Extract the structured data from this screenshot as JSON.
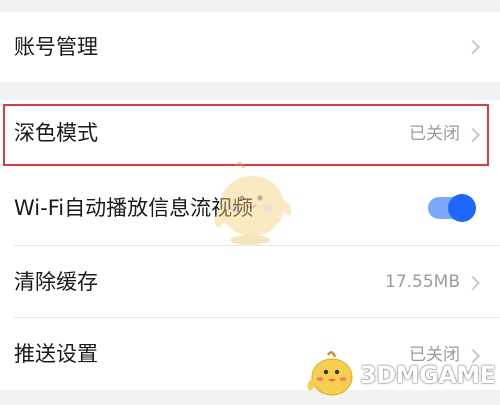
{
  "settings": {
    "items": [
      {
        "label": "账号管理",
        "value": ""
      },
      {
        "label": "深色模式",
        "value": "已关闭"
      },
      {
        "label": "Wi-Fi自动播放信息流视频",
        "toggle": true
      },
      {
        "label": "清除缓存",
        "value": "17.55MB"
      },
      {
        "label": "推送设置",
        "value": "已关闭"
      }
    ]
  },
  "colors": {
    "highlight": "#e23a3a",
    "toggle_on": "#1f66ff",
    "background": "#f2f2f2"
  },
  "icons": {
    "chevron": "chevron-right-icon",
    "mascot": "bird-mascot-icon"
  },
  "watermark": {
    "text": "3DMGAME"
  }
}
